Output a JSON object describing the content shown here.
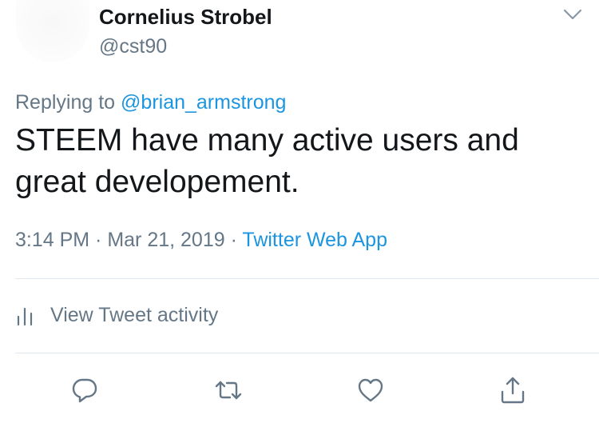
{
  "user": {
    "display_name": "Cornelius Strobel",
    "handle": "@cst90"
  },
  "reply": {
    "prefix": "Replying to ",
    "mention": "@brian_armstrong"
  },
  "tweet": {
    "line1": "STEEM have many active users and",
    "line2": "great developement."
  },
  "meta": {
    "time": "3:14 PM",
    "separator1": " · ",
    "date": "Mar 21, 2019",
    "separator2": " · ",
    "source": "Twitter Web App"
  },
  "activity": {
    "label": "View Tweet activity",
    "icon": "bar-chart-icon"
  },
  "actions": {
    "reply_icon": "reply-bubble-icon",
    "retweet_icon": "retweet-icon",
    "like_icon": "heart-icon",
    "share_icon": "share-icon"
  },
  "colors": {
    "text": "#14171a",
    "secondary": "#657786",
    "accent": "#1b95e0",
    "divider": "#e1e8ed"
  }
}
